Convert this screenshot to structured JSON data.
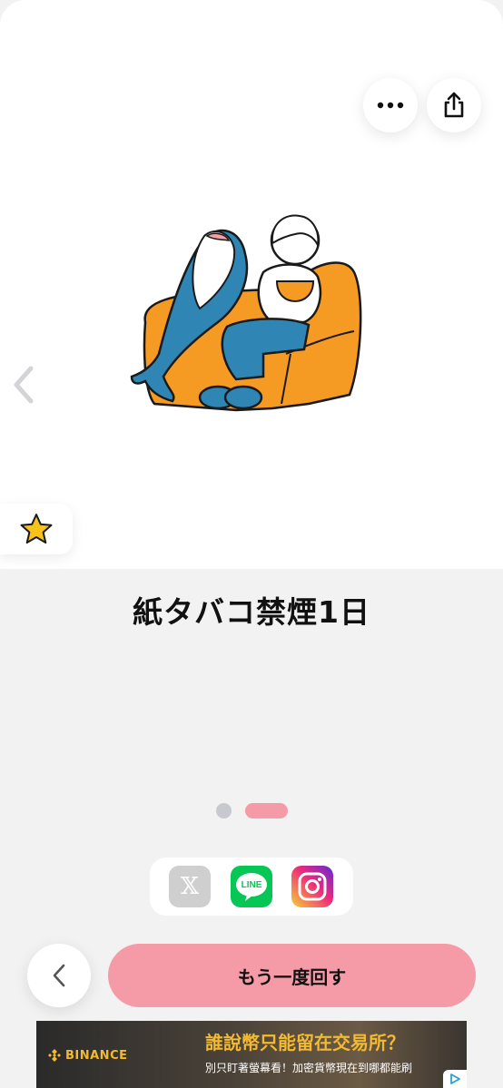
{
  "result": {
    "title": "紙タバコ禁煙1日"
  },
  "toolbar": {
    "more_icon": "ellipsis-icon",
    "share_icon": "share-icon"
  },
  "illustration": {
    "description_icon": "illustration"
  },
  "pagination": {
    "total": 2,
    "active_index": 1
  },
  "share": {
    "x_label": "𝕏",
    "line_label": "LINE"
  },
  "actions": {
    "spin_again_label": "もう一度回す"
  },
  "ad": {
    "brand": "BINANCE",
    "headline": "誰說幣只能留在交易所？",
    "subtext": "別只盯著螢幕看！加密貨幣現在到哪都能刷"
  },
  "colors": {
    "accent_pink": "#f59aa7",
    "line_green": "#06c755",
    "binance_yellow": "#f3ba2f",
    "background": "#f2f2f2"
  }
}
